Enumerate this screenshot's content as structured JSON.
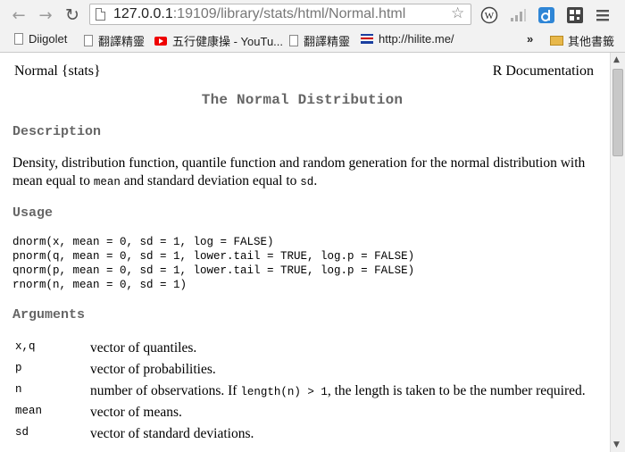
{
  "browser": {
    "url_host": "127.0.0.1",
    "url_rest": ":19109/library/stats/html/Normal.html",
    "bookmarks": [
      {
        "label": "Diigolet",
        "icon": "document-icon"
      },
      {
        "label": "翻譯精靈",
        "icon": "document-icon"
      },
      {
        "label": "五行健康操 - YouTu...",
        "icon": "youtube-icon"
      },
      {
        "label": "翻譯精靈",
        "icon": "document-icon"
      },
      {
        "label": "http://hilite.me/",
        "icon": "hilite-icon"
      }
    ],
    "overflow": "»",
    "other_bookmarks": "其他書籤"
  },
  "doc": {
    "header_left": "Normal {stats}",
    "header_right": "R Documentation",
    "title": "The Normal Distribution",
    "description_heading": "Description",
    "description": {
      "text1": "Density, distribution function, quantile function and random generation for the normal distribution with mean equal to ",
      "code1": "mean",
      "text2": " and standard deviation equal to ",
      "code2": "sd",
      "text3": "."
    },
    "usage_heading": "Usage",
    "usage_lines": [
      "dnorm(x, mean = 0, sd = 1, log = FALSE)",
      "pnorm(q, mean = 0, sd = 1, lower.tail = TRUE, log.p = FALSE)",
      "qnorm(p, mean = 0, sd = 1, lower.tail = TRUE, log.p = FALSE)",
      "rnorm(n, mean = 0, sd = 1)"
    ],
    "arguments_heading": "Arguments",
    "arguments": [
      {
        "name": "x,q",
        "desc": "vector of quantiles."
      },
      {
        "name": "p",
        "desc": "vector of probabilities."
      },
      {
        "name": "n",
        "desc_pre": "number of observations. If ",
        "desc_code": "length(n) > 1",
        "desc_post": ", the length is taken to be the number required."
      },
      {
        "name": "mean",
        "desc": "vector of means."
      },
      {
        "name": "sd",
        "desc": "vector of standard deviations."
      }
    ]
  }
}
